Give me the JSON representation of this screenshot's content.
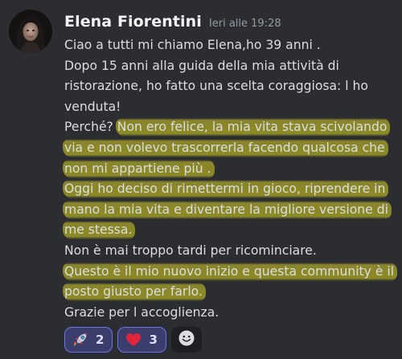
{
  "message": {
    "author": "Elena Fiorentini",
    "timestamp": "Ieri alle 19:28",
    "lines": [
      {
        "text": "Ciao a tutti mi chiamo Elena,ho 39 anni .",
        "highlighted": false
      },
      {
        "text": "Dopo 15 anni alla guida della mia attività di",
        "highlighted": false
      },
      {
        "text": "ristorazione, ho fatto una scelta coraggiosa: l ho",
        "highlighted": false
      },
      {
        "text": "venduta!",
        "highlighted": false
      },
      {
        "prefix": "Perché? ",
        "text": "Non ero felice, la mia vita stava scivolando",
        "highlighted": true
      },
      {
        "text": "via e non volevo trascorrerla facendo qualcosa che",
        "highlighted": true
      },
      {
        "text": "non mi appartiene più .",
        "highlighted": true
      },
      {
        "text": "Oggi ho deciso di rimettermi in gioco, riprendere in",
        "highlighted": true
      },
      {
        "text": "mano la mia vita e diventare la migliore versione di",
        "highlighted": true
      },
      {
        "text": "me stessa.",
        "highlighted": true
      },
      {
        "text": "Non è mai troppo tardi per ricominciare.",
        "highlighted": false
      },
      {
        "text": "Questo è il mio nuovo inizio e questa community è il",
        "highlighted": true
      },
      {
        "text": "posto giusto per farlo.",
        "highlighted": true
      },
      {
        "text": "Grazie per l accoglienza.",
        "highlighted": false
      }
    ]
  },
  "reactions": [
    {
      "emoji": "rocket-icon",
      "count": "2"
    },
    {
      "emoji": "red-heart-icon",
      "count": "3"
    }
  ],
  "add_reaction": {
    "icon": "smiley-add-icon"
  },
  "colors": {
    "background": "#2b2d31",
    "highlight": "#d7cd28",
    "reaction_border": "#6b74e8"
  }
}
